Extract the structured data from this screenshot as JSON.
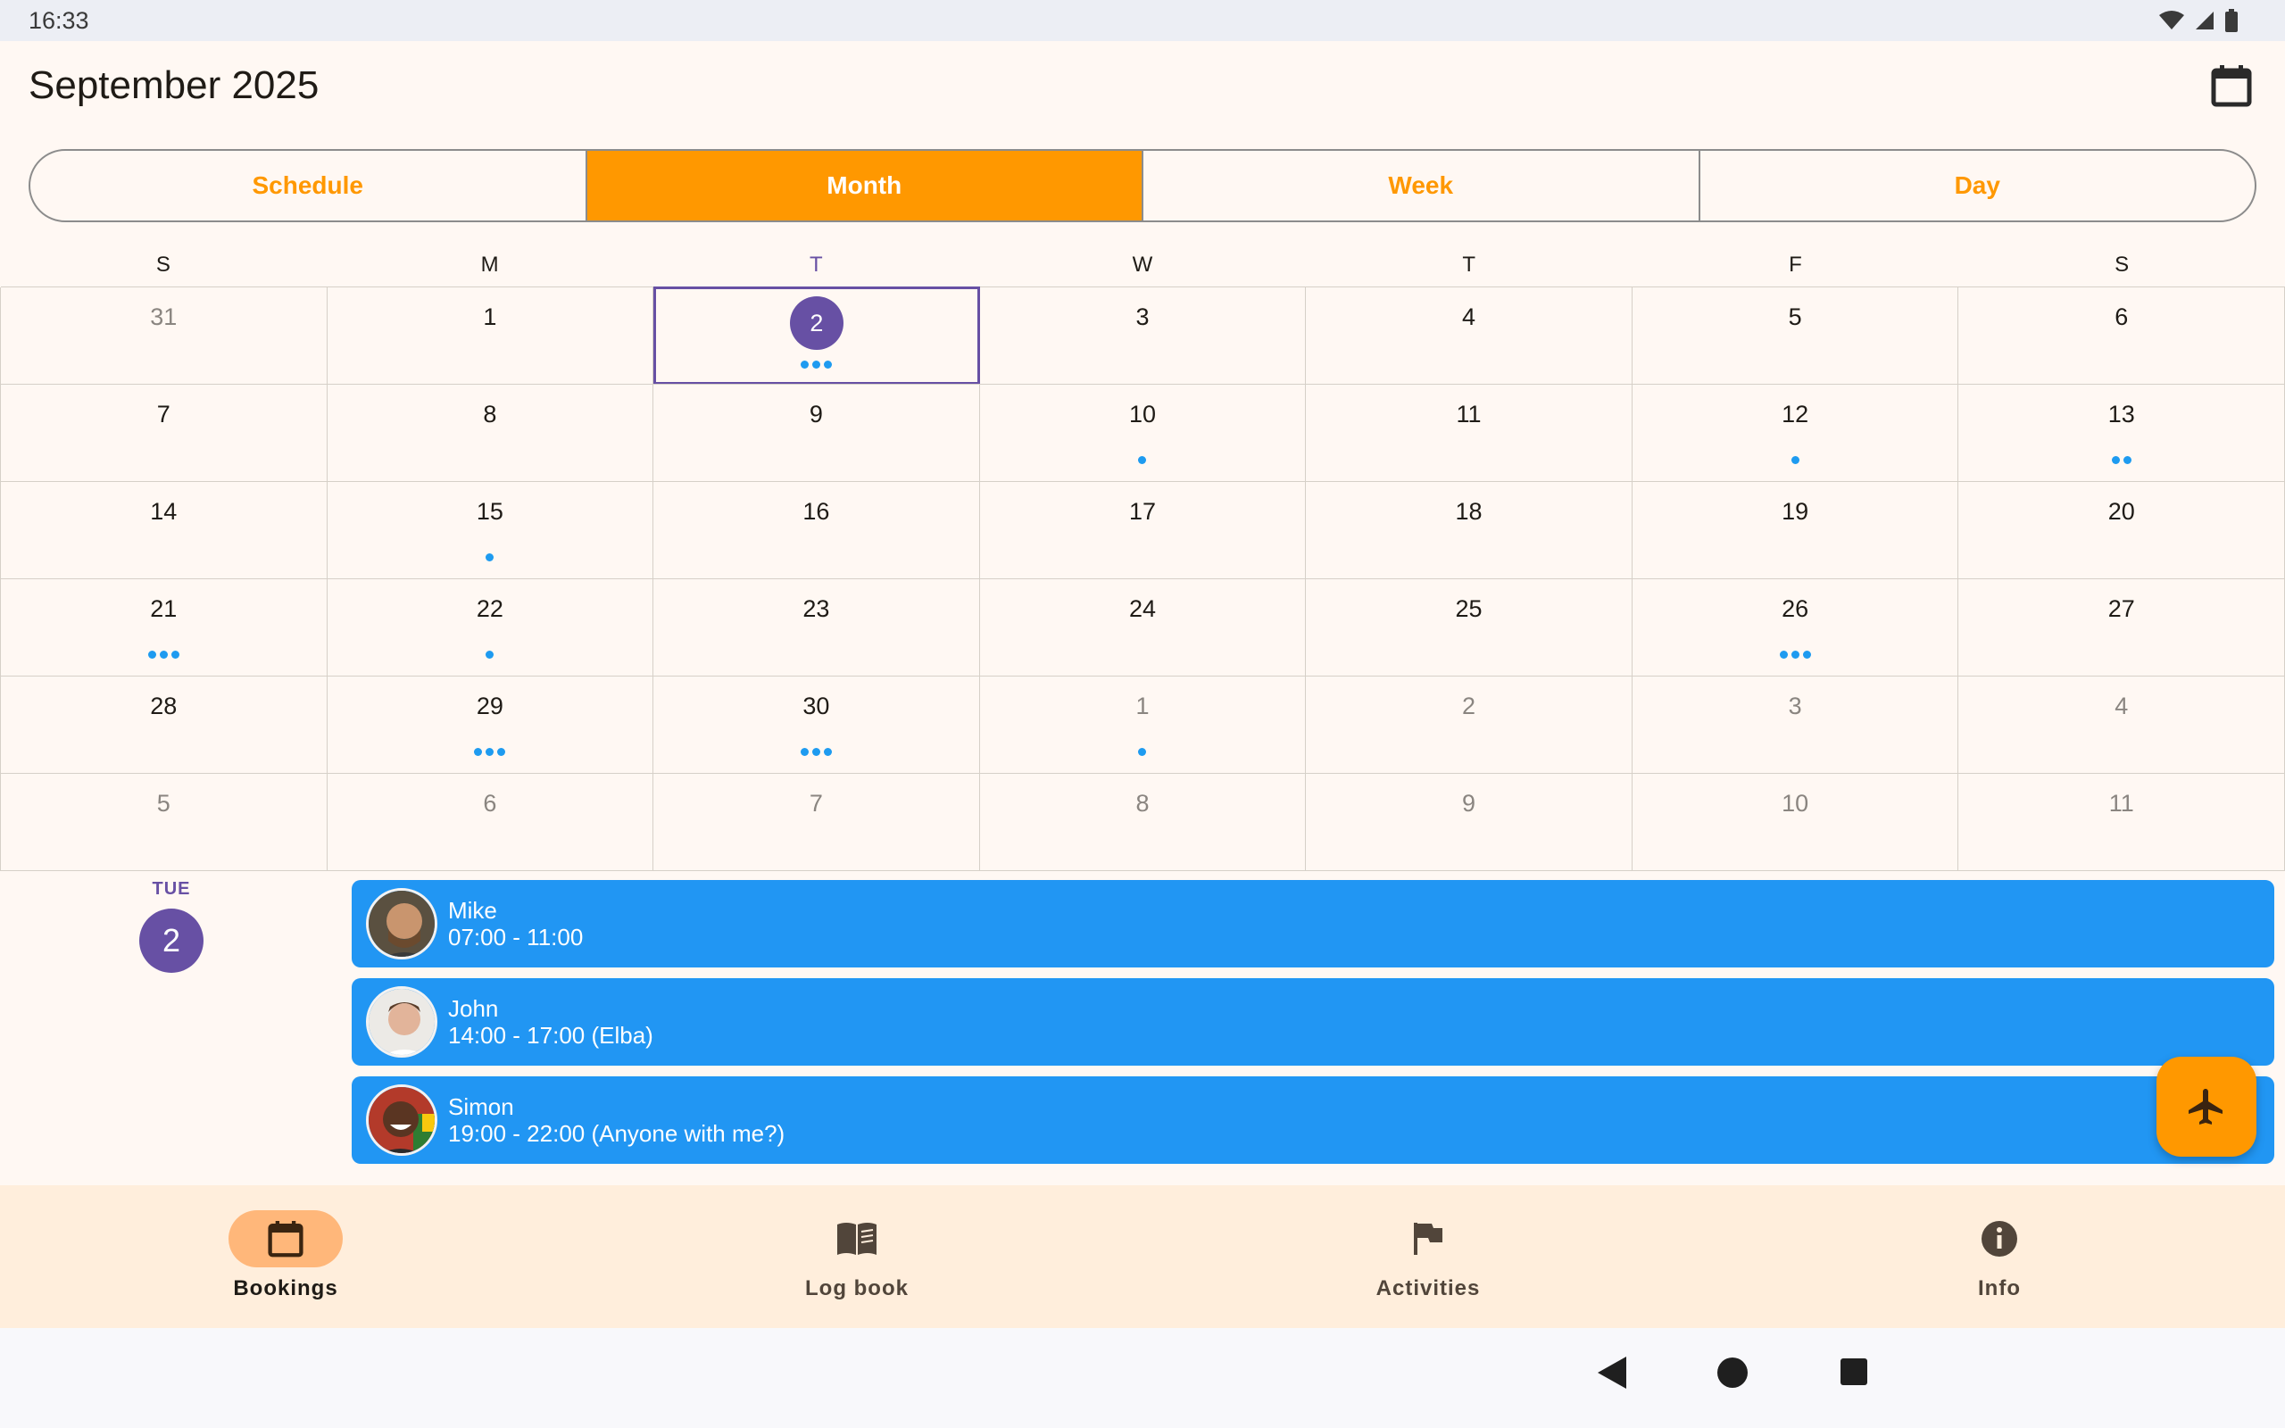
{
  "status_bar": {
    "time": "16:33"
  },
  "app_bar": {
    "title": "September 2025",
    "calendar_button": "calendar-icon"
  },
  "view_tabs": [
    {
      "label": "Schedule",
      "active": false
    },
    {
      "label": "Month",
      "active": true
    },
    {
      "label": "Week",
      "active": false
    },
    {
      "label": "Day",
      "active": false
    }
  ],
  "weekdays": [
    "S",
    "M",
    "T",
    "W",
    "T",
    "F",
    "S"
  ],
  "today_weekday_index": 2,
  "calendar": {
    "weeks": [
      [
        {
          "day": "31",
          "muted": true,
          "dots": 0
        },
        {
          "day": "1",
          "dots": 0
        },
        {
          "day": "2",
          "selected": true,
          "dots": 3
        },
        {
          "day": "3",
          "dots": 0
        },
        {
          "day": "4",
          "dots": 0
        },
        {
          "day": "5",
          "dots": 0
        },
        {
          "day": "6",
          "dots": 0
        }
      ],
      [
        {
          "day": "7",
          "dots": 0
        },
        {
          "day": "8",
          "dots": 0
        },
        {
          "day": "9",
          "dots": 0
        },
        {
          "day": "10",
          "dots": 1
        },
        {
          "day": "11",
          "dots": 0
        },
        {
          "day": "12",
          "dots": 1
        },
        {
          "day": "13",
          "dots": 2
        }
      ],
      [
        {
          "day": "14",
          "dots": 0
        },
        {
          "day": "15",
          "dots": 1
        },
        {
          "day": "16",
          "dots": 0
        },
        {
          "day": "17",
          "dots": 0
        },
        {
          "day": "18",
          "dots": 0
        },
        {
          "day": "19",
          "dots": 0
        },
        {
          "day": "20",
          "dots": 0
        }
      ],
      [
        {
          "day": "21",
          "dots": 3
        },
        {
          "day": "22",
          "dots": 1
        },
        {
          "day": "23",
          "dots": 0
        },
        {
          "day": "24",
          "dots": 0
        },
        {
          "day": "25",
          "dots": 0
        },
        {
          "day": "26",
          "dots": 3
        },
        {
          "day": "27",
          "dots": 0
        }
      ],
      [
        {
          "day": "28",
          "dots": 0
        },
        {
          "day": "29",
          "dots": 3
        },
        {
          "day": "30",
          "dots": 3
        },
        {
          "day": "1",
          "muted": true,
          "dots": 1
        },
        {
          "day": "2",
          "muted": true,
          "dots": 0
        },
        {
          "day": "3",
          "muted": true,
          "dots": 0
        },
        {
          "day": "4",
          "muted": true,
          "dots": 0
        }
      ],
      [
        {
          "day": "5",
          "muted": true,
          "dots": 0
        },
        {
          "day": "6",
          "muted": true,
          "dots": 0
        },
        {
          "day": "7",
          "muted": true,
          "dots": 0
        },
        {
          "day": "8",
          "muted": true,
          "dots": 0
        },
        {
          "day": "9",
          "muted": true,
          "dots": 0
        },
        {
          "day": "10",
          "muted": true,
          "dots": 0
        },
        {
          "day": "11",
          "muted": true,
          "dots": 0
        }
      ]
    ]
  },
  "agenda": {
    "weekday": "TUE",
    "date": "2",
    "events": [
      {
        "name": "Mike",
        "time": "07:00 - 11:00",
        "avatar": "avatar-mike"
      },
      {
        "name": "John",
        "time": "14:00 - 17:00 (Elba)",
        "avatar": "avatar-john"
      },
      {
        "name": "Simon",
        "time": "19:00 - 22:00 (Anyone with me?)",
        "avatar": "avatar-simon"
      }
    ]
  },
  "fab": {
    "icon": "airplane-icon"
  },
  "bottom_nav": [
    {
      "label": "Bookings",
      "icon": "calendar-icon",
      "active": true
    },
    {
      "label": "Log book",
      "icon": "book-icon",
      "active": false
    },
    {
      "label": "Activities",
      "icon": "flag-icon",
      "active": false
    },
    {
      "label": "Info",
      "icon": "info-icon",
      "active": false
    }
  ],
  "colors": {
    "accent": "#ff9800",
    "primary": "#6750a4",
    "event": "#2196f3",
    "dot": "#1e9bf0",
    "background": "#fff8f3",
    "nav_background": "#ffeedc"
  }
}
